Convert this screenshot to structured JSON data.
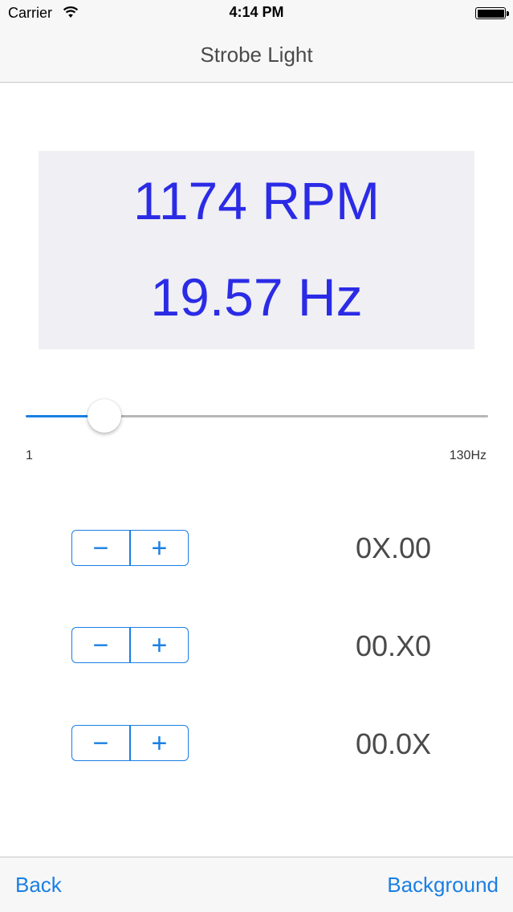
{
  "status_bar": {
    "carrier": "Carrier",
    "time": "4:14 PM",
    "wifi_icon": "wifi-icon",
    "battery_icon": "battery-full-icon"
  },
  "nav": {
    "title": "Strobe Light"
  },
  "readout": {
    "rpm": "1174 RPM",
    "frequency": "19.57 Hz"
  },
  "slider": {
    "min_label": "1",
    "max_label": "130Hz",
    "min": 1,
    "max": 130,
    "value": 19.57
  },
  "steppers": [
    {
      "minus": "−",
      "plus": "+",
      "value": "0X.00"
    },
    {
      "minus": "−",
      "plus": "+",
      "value": "00.X0"
    },
    {
      "minus": "−",
      "plus": "+",
      "value": "00.0X"
    }
  ],
  "toolbar": {
    "back_label": "Back",
    "background_label": "Background"
  },
  "colors": {
    "accent": "#1a7fe4",
    "readout_text": "#2b2be6",
    "readout_bg": "#efeff4"
  }
}
